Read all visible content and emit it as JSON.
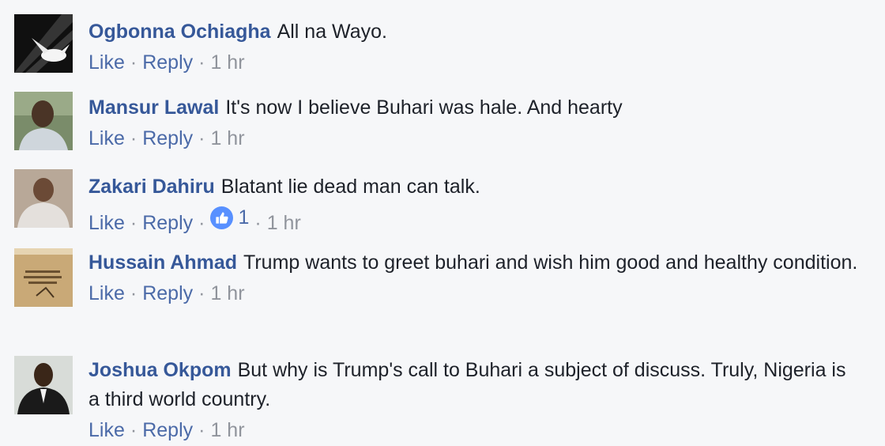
{
  "comments": [
    {
      "author": "Ogbonna Ochiagha",
      "text": "All na Wayo.",
      "like": "Like",
      "reply": "Reply",
      "time": "1 hr",
      "avatar": "dove-image"
    },
    {
      "author": "Mansur Lawal",
      "text": "It's now I believe Buhari was hale. And hearty",
      "like": "Like",
      "reply": "Reply",
      "time": "1 hr",
      "avatar": "man-photo"
    },
    {
      "author": "Zakari Dahiru",
      "text": "Blatant lie dead man can talk.",
      "like": "Like",
      "reply": "Reply",
      "reaction_count": "1",
      "reaction_icon": "thumbs-up-icon",
      "time": "1 hr",
      "avatar": "man-photo"
    },
    {
      "author": "Hussain Ahmad",
      "text": "Trump wants to greet buhari and wish him good and healthy condition.",
      "like": "Like",
      "reply": "Reply",
      "time": "1 hr",
      "avatar": "quote-image"
    },
    {
      "author": "Joshua Okpom",
      "text": "But why is Trump's call to Buhari a subject of discuss. Truly, Nigeria is a third world country.",
      "like": "Like",
      "reply": "Reply",
      "time": "1 hr",
      "avatar": "man-photo"
    }
  ],
  "colors": {
    "background": "#f6f7f9",
    "author": "#365899",
    "link": "#4b6aa8",
    "meta": "#90949c",
    "like_badge": "#5890ff"
  }
}
